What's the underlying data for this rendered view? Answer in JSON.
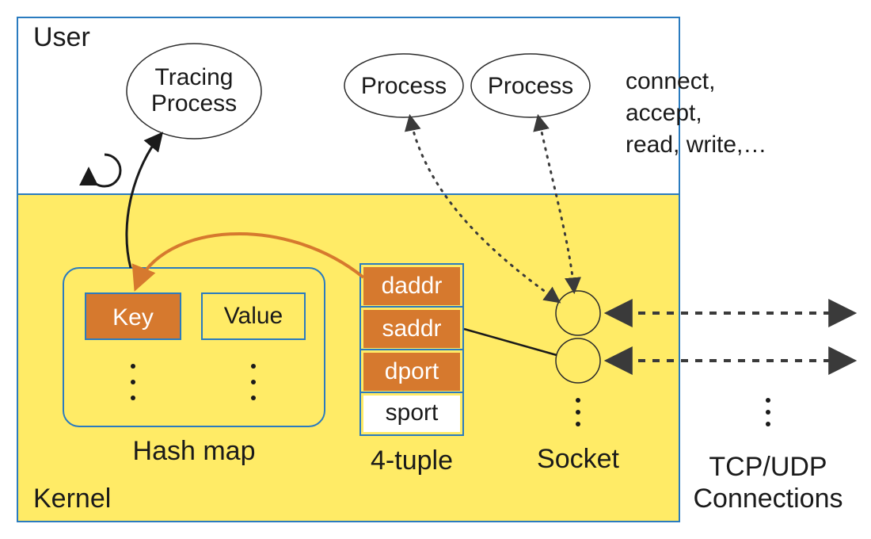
{
  "diagram": {
    "outer_box": {
      "user_label": "User",
      "kernel_label": "Kernel"
    },
    "tracing_process": {
      "line1": "Tracing",
      "line2": "Process"
    },
    "processes": {
      "p1": "Process",
      "p2": "Process"
    },
    "syscalls": {
      "line1": "connect,",
      "line2": "accept,",
      "line3": "read, write,…"
    },
    "hashmap": {
      "title": "Hash map",
      "key_label": "Key",
      "value_label": "Value"
    },
    "four_tuple": {
      "title": "4-tuple",
      "daddr": "daddr",
      "saddr": "saddr",
      "dport": "dport",
      "sport": "sport"
    },
    "socket_label": "Socket",
    "connections": {
      "line1": "TCP/UDP",
      "line2": "Connections"
    },
    "colors": {
      "kernel_bg": "#ffeb66",
      "orange": "#d6792e",
      "blue": "#2a7bbf",
      "arrow_gray": "#3a3a3a"
    }
  }
}
